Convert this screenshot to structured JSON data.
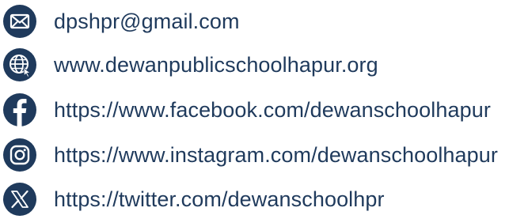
{
  "contacts": {
    "accent_color": "#1f3a5c",
    "items": [
      {
        "icon": "envelope-icon",
        "text": "dpshpr@gmail.com"
      },
      {
        "icon": "globe-icon",
        "text": "www.dewanpublicschoolhapur.org"
      },
      {
        "icon": "facebook-icon",
        "text": "https://www.facebook.com/dewanschoolhapur"
      },
      {
        "icon": "instagram-icon",
        "text": "https://www.instagram.com/dewanschoolhapur"
      },
      {
        "icon": "x-twitter-icon",
        "text": "https://twitter.com/dewanschoolhpr"
      }
    ]
  }
}
